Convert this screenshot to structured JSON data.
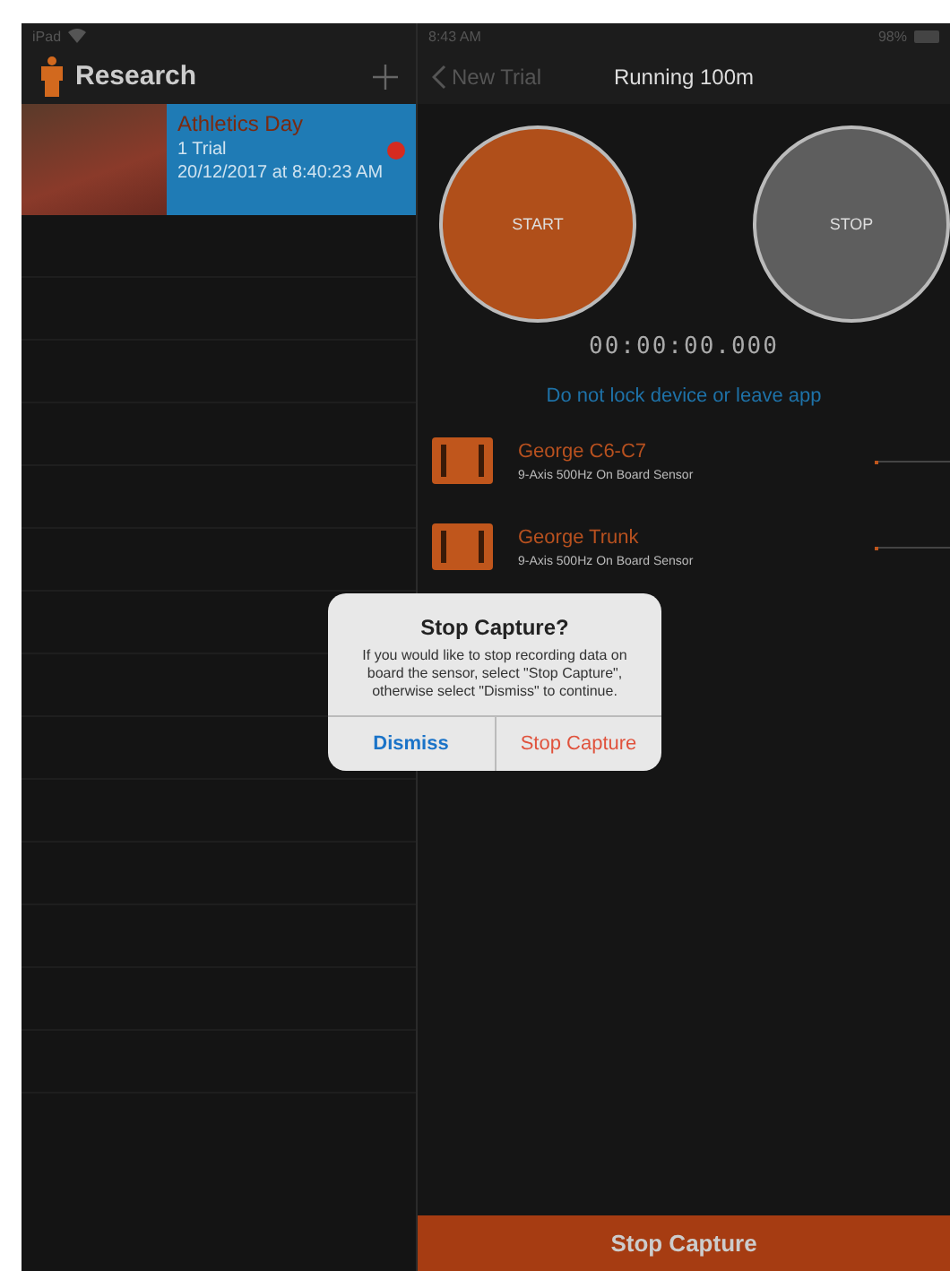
{
  "status_bar": {
    "device": "iPad",
    "time": "8:43 AM",
    "battery": "98%"
  },
  "sidebar": {
    "title": "Research",
    "items": [
      {
        "title": "Athletics Day",
        "subtitle": "1 Trial",
        "date": "20/12/2017 at 8:40:23 AM",
        "selected": true
      }
    ]
  },
  "nav": {
    "back": "New Trial",
    "title": "Running 100m"
  },
  "controls": {
    "start": "START",
    "stop": "STOP",
    "timer": "00:00:00.000",
    "warning": "Do not lock device or leave app"
  },
  "sensors": [
    {
      "name": "George C6-C7",
      "detail": "9-Axis 500Hz On Board Sensor",
      "level": 0.05
    },
    {
      "name": "George Trunk",
      "detail": "9-Axis 500Hz On Board Sensor",
      "level": 0.05
    }
  ],
  "dialog": {
    "title": "Stop Capture?",
    "message": "If you would like to stop recording data on board the sensor, select \"Stop Capture\", otherwise select \"Dismiss\" to continue.",
    "buttons": [
      {
        "label": "Dismiss",
        "kind": "cancel"
      },
      {
        "label": "Stop Capture",
        "kind": "destructive"
      }
    ]
  },
  "bottom_button": "Stop Capture"
}
